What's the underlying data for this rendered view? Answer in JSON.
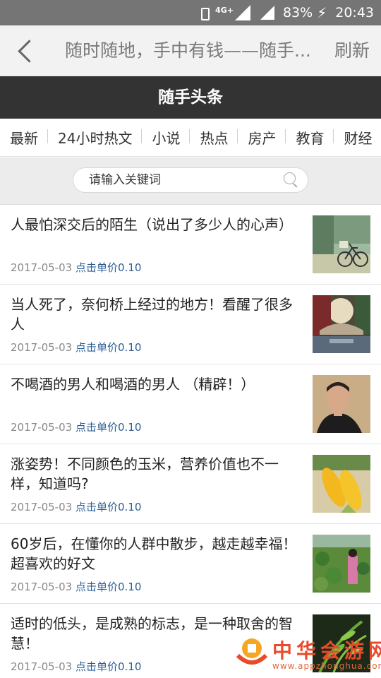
{
  "status_bar": {
    "network": "4G+",
    "battery": "83%",
    "time": "20:43"
  },
  "top_bar": {
    "back_icon": "chevron-left-icon",
    "title": "随时随地，手中有钱——随手...",
    "refresh_label": "刷新"
  },
  "site_header": {
    "title": "随手头条"
  },
  "tabs": [
    {
      "label": "最新"
    },
    {
      "label": "24小时热文"
    },
    {
      "label": "小说"
    },
    {
      "label": "热点"
    },
    {
      "label": "房产"
    },
    {
      "label": "教育"
    },
    {
      "label": "财经"
    }
  ],
  "search": {
    "placeholder": "请输入关键词",
    "icon": "search-icon"
  },
  "news": [
    {
      "title": "人最怕深交后的陌生（说出了多少人的心声）",
      "date": "2017-05-03",
      "price": "点击单价0.10",
      "image": "bicycle-photo"
    },
    {
      "title": "当人死了，奈何桥上经过的地方！看醒了很多人",
      "date": "2017-05-03",
      "price": "点击单价0.10",
      "image": "bridge-painting"
    },
    {
      "title": "不喝酒的男人和喝酒的男人 （精辟！）",
      "date": "2017-05-03",
      "price": "点击单价0.10",
      "image": "man-portrait"
    },
    {
      "title": "涨姿势！不同颜色的玉米，营养价值也不一样，知道吗?",
      "date": "2017-05-03",
      "price": "点击单价0.10",
      "image": "corn-photo"
    },
    {
      "title": "60岁后，在懂你的人群中散步，越走越幸福！超喜欢的好文",
      "date": "2017-05-03",
      "price": "点击单价0.10",
      "image": "lotus-pond-photo"
    },
    {
      "title": "适时的低头，是成熟的标志，是一种取舍的智慧！",
      "date": "2017-05-03",
      "price": "点击单价0.10",
      "image": "bamboo-photo"
    }
  ],
  "watermark": {
    "text": "中华会游网",
    "url": "www.appzhonghua.com"
  },
  "colors": {
    "header_bg": "#333333",
    "status_bar_bg": "#757575",
    "price_blue": "#2a5d93"
  }
}
